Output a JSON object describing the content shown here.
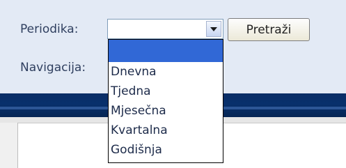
{
  "filters": {
    "periodika_label": "Periodika:",
    "navigacija_label": "Navigacija:",
    "selected_value": "",
    "search_button_label": "Pretraži"
  },
  "dropdown": {
    "options": [
      "",
      "Dnevna",
      "Tjedna",
      "Mjesečna",
      "Kvartalna",
      "Godišnja"
    ],
    "highlighted_index": 0
  },
  "colors": {
    "panel_background": "#e3eaf5",
    "label_text": "#2f3f5f",
    "highlight": "#3168d6",
    "band": "#08306c"
  },
  "icons": {
    "select_arrow": "chevron-down-icon"
  }
}
